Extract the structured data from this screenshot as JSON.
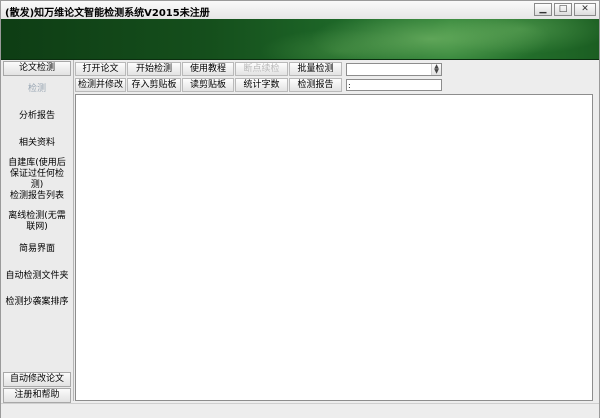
{
  "window": {
    "title": "(散发)知万维论文智能检测系统V2015未注册",
    "controls": {
      "minimize": "▁",
      "maximize": "□",
      "close": "✕"
    }
  },
  "sidebar": {
    "top_button": "论文检测",
    "items": [
      {
        "label": "检测",
        "disabled": true
      },
      {
        "label": "分析报告"
      },
      {
        "label": "相关资料"
      },
      {
        "label": "自建库(使用后保证过任何检测)"
      },
      {
        "label": "检测报告列表"
      },
      {
        "label": "离线检测(无需联网)"
      },
      {
        "label": "简易界面"
      },
      {
        "label": "自动检测文件夹"
      },
      {
        "label": "检测抄袭案排序"
      }
    ],
    "bottom_buttons": [
      "自动修改论文",
      "注册和帮助"
    ]
  },
  "toolbar": {
    "row1": [
      {
        "label": "打开论文"
      },
      {
        "label": "开始检测"
      },
      {
        "label": "使用教程"
      },
      {
        "label": "断点续检",
        "disabled": true
      },
      {
        "label": "批量检测"
      }
    ],
    "row2": [
      {
        "label": "检测并修改"
      },
      {
        "label": "存入剪贴板"
      },
      {
        "label": "读剪贴板"
      },
      {
        "label": "统计字数"
      },
      {
        "label": "检测报告"
      }
    ],
    "combo_value": "",
    "text_value": ":"
  }
}
